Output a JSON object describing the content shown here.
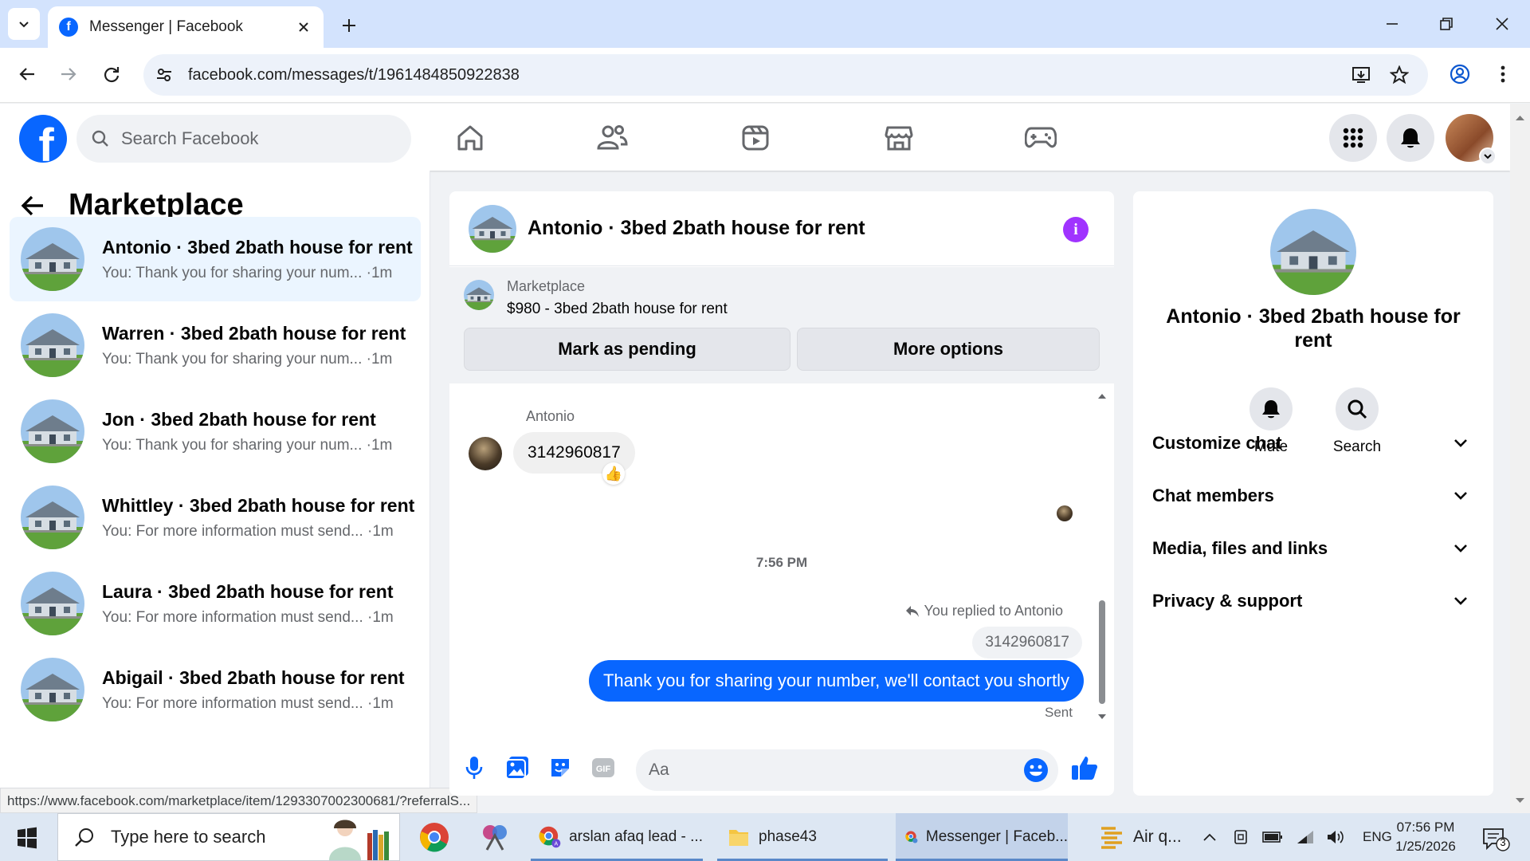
{
  "browser": {
    "tab_title": "Messenger | Facebook",
    "url": "facebook.com/messages/t/1961484850922838",
    "status_url": "https://www.facebook.com/marketplace/item/1293307002300681/?referralS..."
  },
  "header": {
    "search_placeholder": "Search Facebook"
  },
  "sidebar": {
    "title": "Marketplace",
    "conversations": [
      {
        "name": "Antonio · 3bed 2bath house for rent",
        "preview": "You: Thank you for sharing your num... ·1m",
        "active": true
      },
      {
        "name": "Warren · 3bed 2bath house for rent",
        "preview": "You: Thank you for sharing your num... ·1m"
      },
      {
        "name": "Jon · 3bed 2bath house for rent",
        "preview": "You: Thank you for sharing your num... ·1m"
      },
      {
        "name": "Whittley · 3bed 2bath house for rent",
        "preview": "You: For more information must send... ·1m"
      },
      {
        "name": "Laura · 3bed 2bath house for rent",
        "preview": "You: For more information must send... ·1m"
      },
      {
        "name": "Abigail · 3bed 2bath house for rent",
        "preview": "You: For more information must send... ·1m"
      }
    ]
  },
  "chat": {
    "title": "Antonio · 3bed 2bath house for rent",
    "marketplace_label": "Marketplace",
    "listing": "$980 - 3bed 2bath house for rent",
    "mark_pending": "Mark as pending",
    "more_options": "More options",
    "sender": "Antonio",
    "incoming_message": "3142960817",
    "reaction": "👍",
    "timestamp": "7:56 PM",
    "replied_to": "You replied to Antonio",
    "quoted_message": "3142960817",
    "outgoing_message": "Thank you for sharing your number, we'll contact you shortly",
    "status": "Sent",
    "composer_placeholder": "Aa"
  },
  "info_panel": {
    "name": "Antonio · 3bed 2bath house for rent",
    "actions": [
      "Mute",
      "Search"
    ],
    "sections": [
      "Customize chat",
      "Chat members",
      "Media, files and links",
      "Privacy & support"
    ]
  },
  "taskbar": {
    "search_placeholder": "Type here to search",
    "apps": [
      {
        "label": "arslan afaq lead - ..."
      },
      {
        "label": "phase43"
      },
      {
        "label": "Messenger | Faceb..."
      },
      {
        "label": "Air q..."
      }
    ],
    "language": "ENG",
    "time": "07:56 PM",
    "date": "1/25/2026",
    "notification_count": "3"
  },
  "colors": {
    "facebook_blue": "#0866ff",
    "info_purple": "#a033ff",
    "active_conversation": "#ebf5ff"
  }
}
